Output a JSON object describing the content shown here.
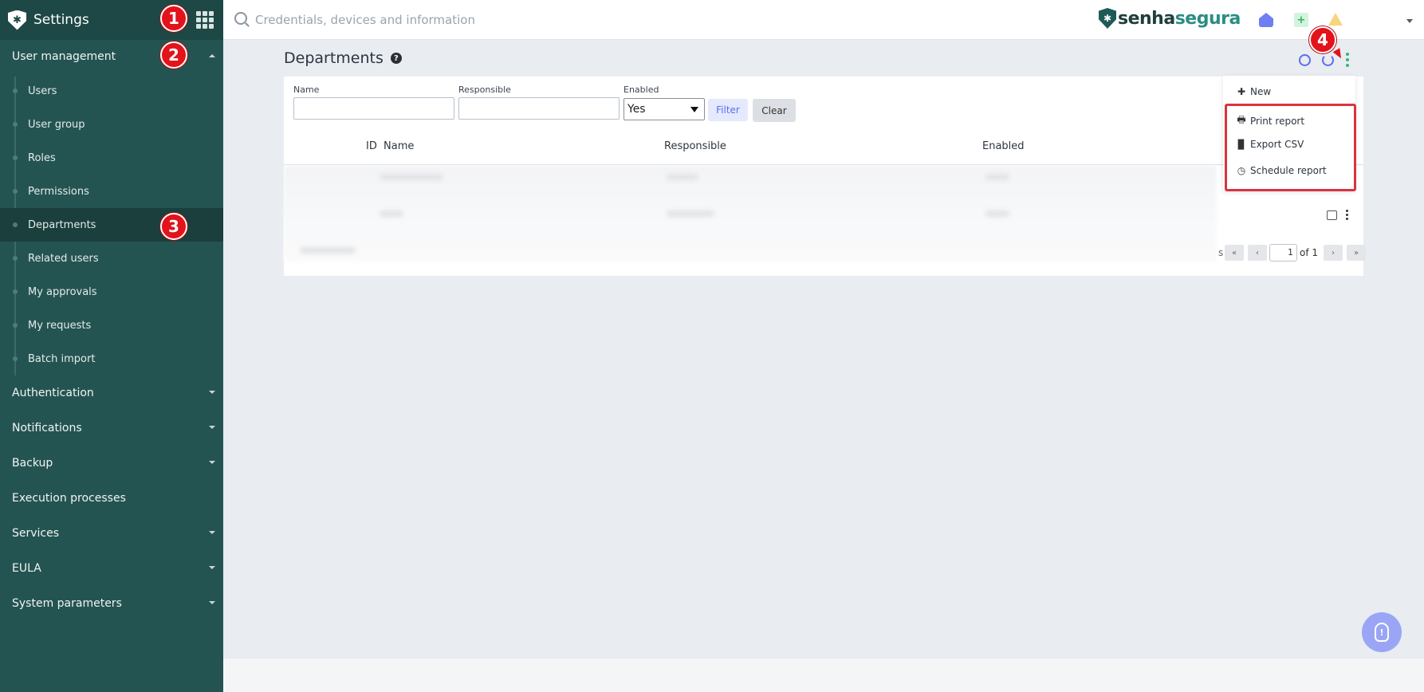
{
  "app": {
    "title": "Settings"
  },
  "topbar": {
    "search_placeholder": "Credentials, devices and information",
    "brand_part1": "senha",
    "brand_part2": "segura"
  },
  "sidebar": {
    "sections": [
      {
        "label": "User management",
        "expanded": true
      },
      {
        "label": "Authentication"
      },
      {
        "label": "Notifications"
      },
      {
        "label": "Backup"
      },
      {
        "label": "Execution processes"
      },
      {
        "label": "Services"
      },
      {
        "label": "EULA"
      },
      {
        "label": "System parameters"
      }
    ],
    "items": [
      {
        "label": "Users"
      },
      {
        "label": "User group"
      },
      {
        "label": "Roles"
      },
      {
        "label": "Permissions"
      },
      {
        "label": "Departments",
        "active": true
      },
      {
        "label": "Related users"
      },
      {
        "label": "My approvals"
      },
      {
        "label": "My requests"
      },
      {
        "label": "Batch import"
      }
    ]
  },
  "main": {
    "title": "Departments",
    "help_glyph": "?",
    "filters": {
      "name_label": "Name",
      "responsible_label": "Responsible",
      "enabled_label": "Enabled",
      "enabled_value": "Yes",
      "filter_button": "Filter",
      "clear_button": "Clear"
    },
    "table": {
      "columns": [
        "ID",
        "Name",
        "Responsible",
        "Enabled"
      ]
    },
    "pagination": {
      "partial_text": "s",
      "first": "«",
      "prev": "‹",
      "next": "›",
      "last": "»",
      "page": "1",
      "of_text": "of 1"
    }
  },
  "menu": {
    "items": [
      {
        "label": "New",
        "icon": "plus-icon",
        "glyph": "✚"
      },
      {
        "label": "Print report",
        "icon": "print-icon",
        "glyph": "🖶"
      },
      {
        "label": "Export CSV",
        "icon": "file-icon",
        "glyph": "▉"
      },
      {
        "label": "Schedule report",
        "icon": "clock-icon",
        "glyph": "◷"
      }
    ]
  },
  "markers": [
    "1",
    "2",
    "3",
    "4"
  ],
  "colors": {
    "sidebar": "#245451",
    "accent": "#5b6df0",
    "highlight": "#d9343e",
    "marker": "#e2131b"
  }
}
